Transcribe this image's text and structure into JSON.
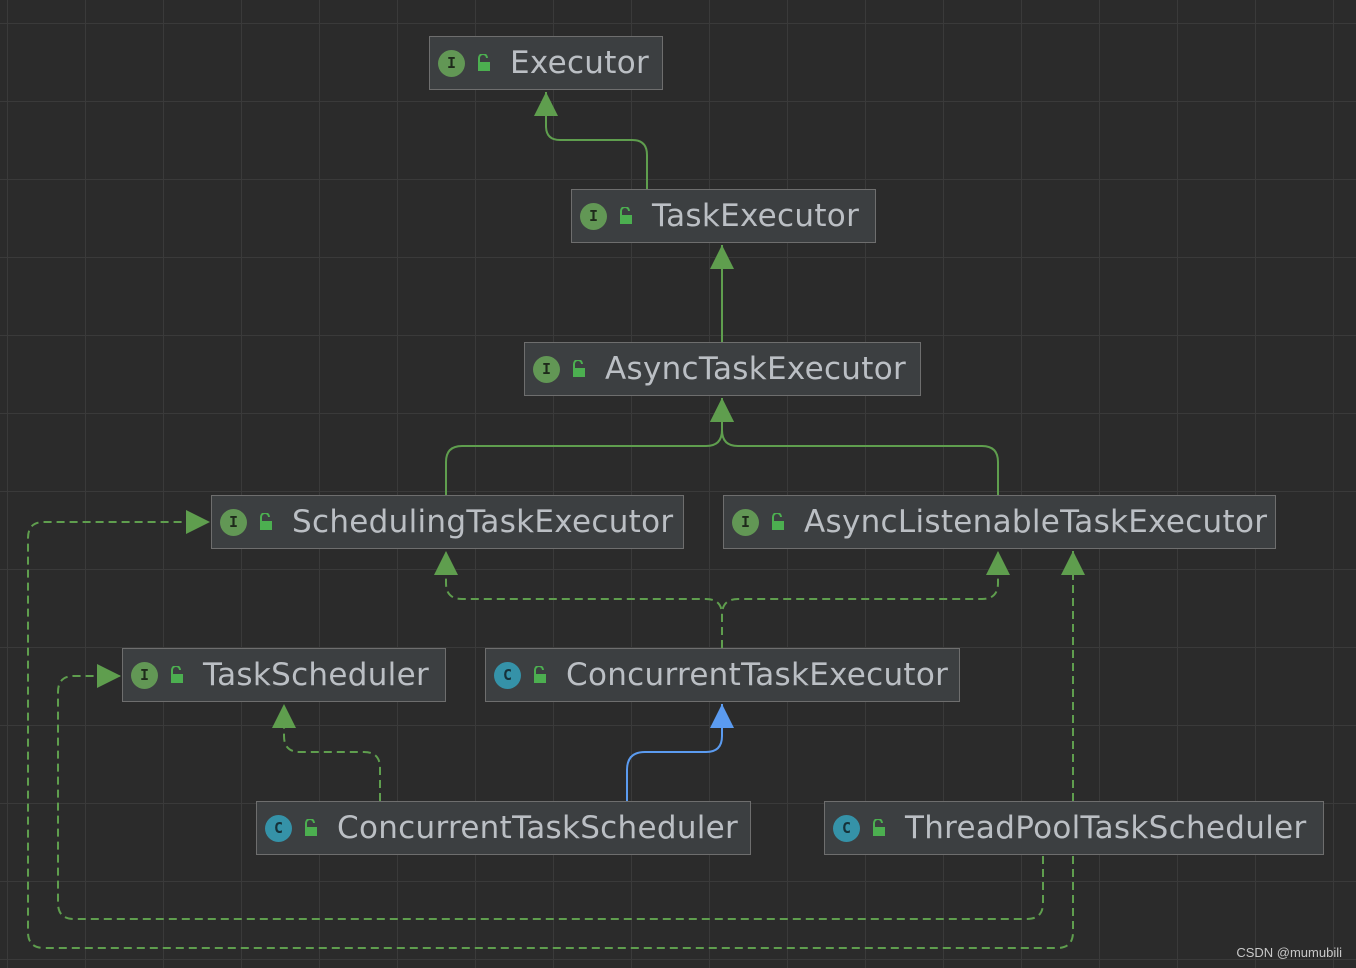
{
  "diagram": {
    "nodes": [
      {
        "id": "Executor",
        "label": "Executor",
        "kind": "interface",
        "badge": "I"
      },
      {
        "id": "TaskExecutor",
        "label": "TaskExecutor",
        "kind": "interface",
        "badge": "I"
      },
      {
        "id": "AsyncTaskExecutor",
        "label": "AsyncTaskExecutor",
        "kind": "interface",
        "badge": "I"
      },
      {
        "id": "SchedulingTaskExecutor",
        "label": "SchedulingTaskExecutor",
        "kind": "interface",
        "badge": "I"
      },
      {
        "id": "AsyncListenableTaskExecutor",
        "label": "AsyncListenableTaskExecutor",
        "kind": "interface",
        "badge": "I"
      },
      {
        "id": "TaskScheduler",
        "label": "TaskScheduler",
        "kind": "interface",
        "badge": "I"
      },
      {
        "id": "ConcurrentTaskExecutor",
        "label": "ConcurrentTaskExecutor",
        "kind": "class",
        "badge": "C"
      },
      {
        "id": "ConcurrentTaskScheduler",
        "label": "ConcurrentTaskScheduler",
        "kind": "class",
        "badge": "C"
      },
      {
        "id": "ThreadPoolTaskScheduler",
        "label": "ThreadPoolTaskScheduler",
        "kind": "class",
        "badge": "C"
      }
    ],
    "edges": [
      {
        "from": "TaskExecutor",
        "to": "Executor",
        "type": "extends-interface"
      },
      {
        "from": "AsyncTaskExecutor",
        "to": "TaskExecutor",
        "type": "extends-interface"
      },
      {
        "from": "SchedulingTaskExecutor",
        "to": "AsyncTaskExecutor",
        "type": "extends-interface"
      },
      {
        "from": "AsyncListenableTaskExecutor",
        "to": "AsyncTaskExecutor",
        "type": "extends-interface"
      },
      {
        "from": "ConcurrentTaskExecutor",
        "to": "SchedulingTaskExecutor",
        "type": "implements"
      },
      {
        "from": "ConcurrentTaskExecutor",
        "to": "AsyncListenableTaskExecutor",
        "type": "implements"
      },
      {
        "from": "ConcurrentTaskScheduler",
        "to": "TaskScheduler",
        "type": "implements"
      },
      {
        "from": "ConcurrentTaskScheduler",
        "to": "ConcurrentTaskExecutor",
        "type": "extends-class"
      },
      {
        "from": "ThreadPoolTaskScheduler",
        "to": "AsyncListenableTaskExecutor",
        "type": "implements"
      },
      {
        "from": "ThreadPoolTaskScheduler",
        "to": "TaskScheduler",
        "type": "implements"
      },
      {
        "from": "ThreadPoolTaskScheduler",
        "to": "SchedulingTaskExecutor",
        "type": "implements"
      }
    ]
  },
  "colors": {
    "background": "#2b2b2b",
    "interface_edge": "#5f9e4e",
    "class_edge": "#5b9bf0",
    "interface_badge": "#629755",
    "class_badge": "#3592a8",
    "lock_icon": "#4caf50"
  },
  "icons": {
    "interface_badge": "interface-icon",
    "class_badge": "class-icon",
    "visibility": "lock-open-icon"
  },
  "watermark": "CSDN @mumubili"
}
